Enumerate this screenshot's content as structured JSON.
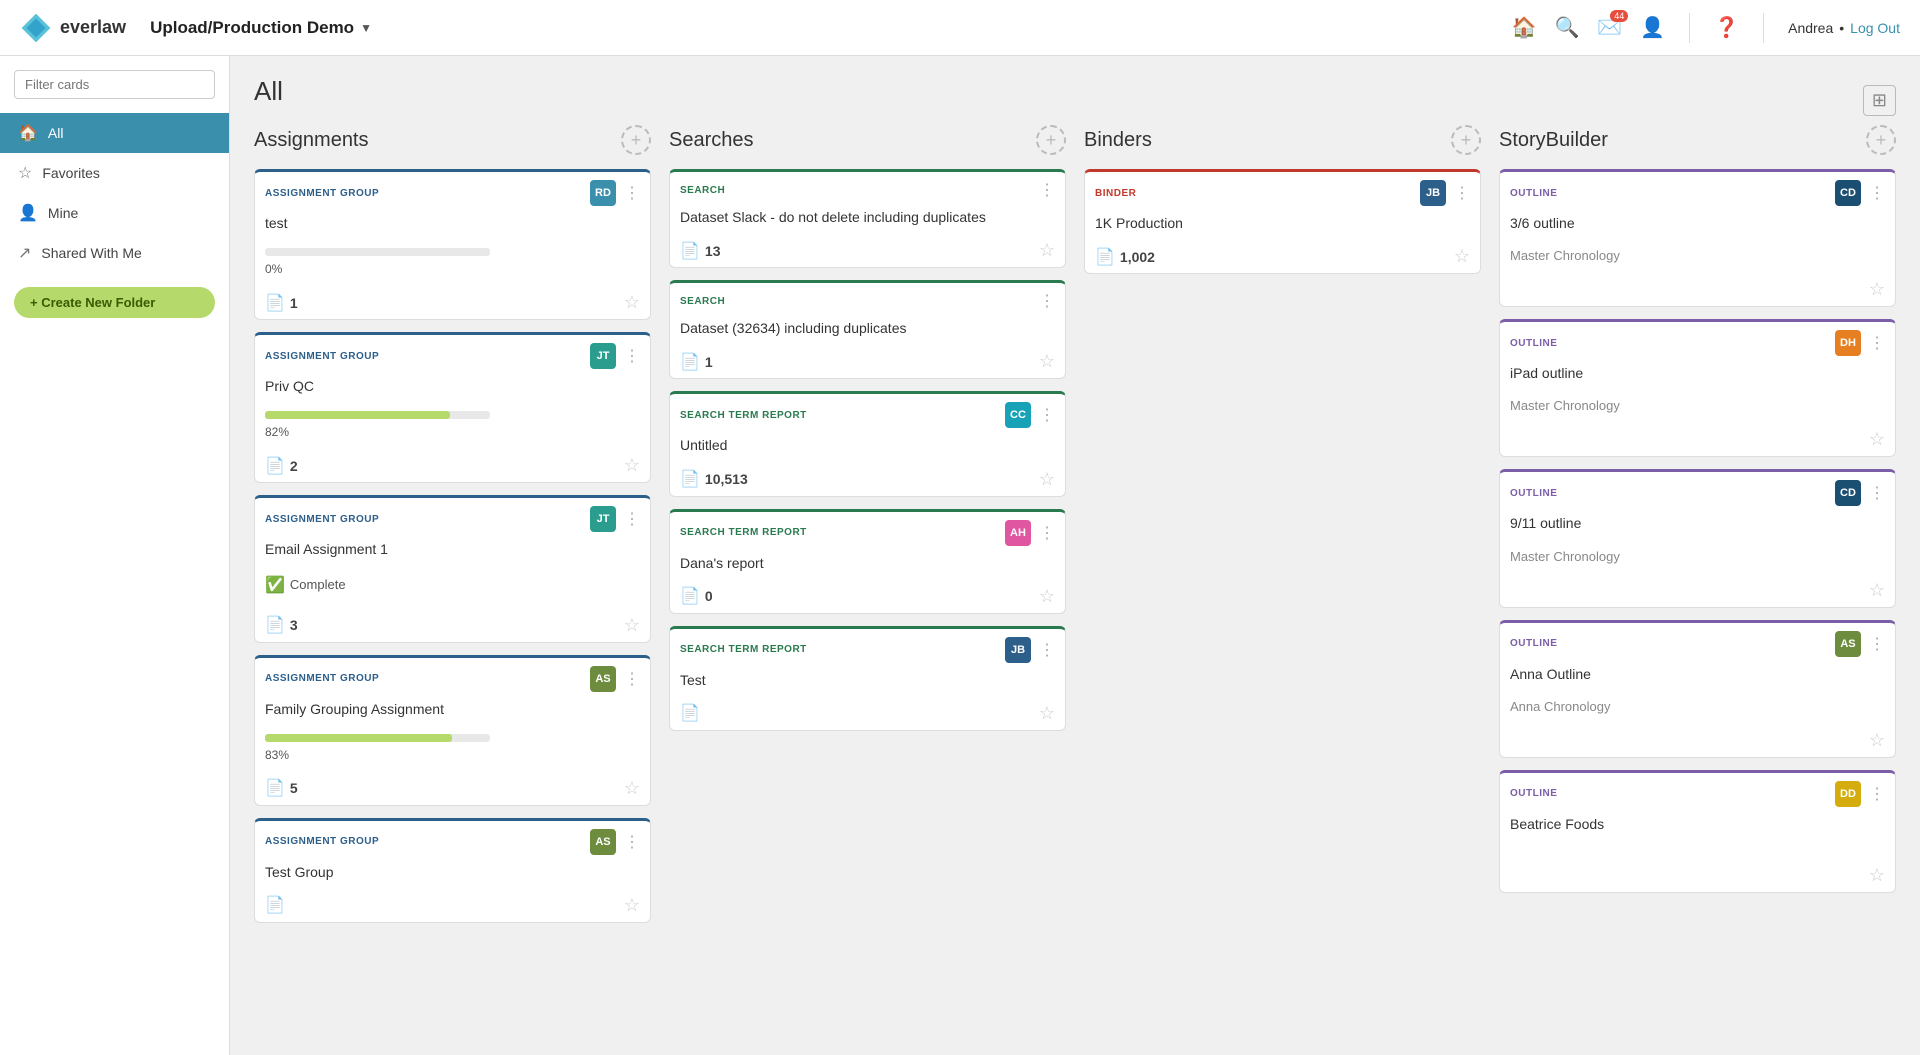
{
  "topnav": {
    "logo_text": "everlaw",
    "project_name": "Upload/Production Demo",
    "notification_count": "44",
    "user_name": "Andrea",
    "logout_label": "Log Out"
  },
  "sidebar": {
    "filter_placeholder": "Filter cards",
    "items": [
      {
        "id": "all",
        "label": "All",
        "icon": "🏠",
        "active": true
      },
      {
        "id": "favorites",
        "label": "Favorites",
        "icon": "☆",
        "active": false
      },
      {
        "id": "mine",
        "label": "Mine",
        "icon": "👤",
        "active": false
      },
      {
        "id": "shared",
        "label": "Shared With Me",
        "icon": "↗",
        "active": false
      }
    ],
    "create_folder_label": "+ Create New Folder"
  },
  "main": {
    "section_title": "All",
    "columns": [
      {
        "id": "assignments",
        "title": "Assignments",
        "cards": [
          {
            "type": "ASSIGNMENT GROUP",
            "type_key": "assignment",
            "name": "test",
            "avatar_initials": "RD",
            "avatar_color": "av-blue",
            "progress_pct": 0,
            "progress_label": "0%",
            "count": 1,
            "show_progress": true,
            "show_complete": false
          },
          {
            "type": "ASSIGNMENT GROUP",
            "type_key": "assignment",
            "name": "Priv QC",
            "avatar_initials": "JT",
            "avatar_color": "av-teal",
            "progress_pct": 82,
            "progress_label": "82%",
            "progress_color": "#b5d96b",
            "count": 2,
            "show_progress": true,
            "show_complete": false
          },
          {
            "type": "ASSIGNMENT GROUP",
            "type_key": "assignment",
            "name": "Email Assignment 1",
            "avatar_initials": "JT",
            "avatar_color": "av-teal",
            "progress_pct": 100,
            "progress_label": "Complete",
            "count": 3,
            "show_progress": false,
            "show_complete": true
          },
          {
            "type": "ASSIGNMENT GROUP",
            "type_key": "assignment",
            "name": "Family Grouping Assignment",
            "avatar_initials": "AS",
            "avatar_color": "av-olive",
            "progress_pct": 83,
            "progress_label": "83%",
            "progress_color": "#b5d96b",
            "count": 5,
            "show_progress": true,
            "show_complete": false
          },
          {
            "type": "ASSIGNMENT GROUP",
            "type_key": "assignment",
            "name": "Test Group",
            "avatar_initials": "AS",
            "avatar_color": "av-olive",
            "progress_pct": 0,
            "progress_label": "",
            "count": null,
            "show_progress": false,
            "show_complete": false
          }
        ]
      },
      {
        "id": "searches",
        "title": "Searches",
        "cards": [
          {
            "type": "SEARCH",
            "type_key": "search",
            "name": "Dataset Slack - do not delete including duplicates",
            "avatar_initials": null,
            "avatar_color": null,
            "count": 13,
            "count_label": "13"
          },
          {
            "type": "SEARCH",
            "type_key": "search",
            "name": "Dataset (32634) including duplicates",
            "avatar_initials": null,
            "avatar_color": null,
            "count": 1,
            "count_label": "1"
          },
          {
            "type": "SEARCH TERM REPORT",
            "type_key": "str",
            "name": "Untitled",
            "avatar_initials": "CC",
            "avatar_color": "av-cyan",
            "count": 10513,
            "count_label": "10,513"
          },
          {
            "type": "SEARCH TERM REPORT",
            "type_key": "str",
            "name": "Dana's report",
            "avatar_initials": "AH",
            "avatar_color": "av-pink",
            "count": 0,
            "count_label": "0"
          },
          {
            "type": "SEARCH TERM REPORT",
            "type_key": "str",
            "name": "Test",
            "avatar_initials": "JB",
            "avatar_color": "av-navy",
            "count": null,
            "count_label": ""
          }
        ]
      },
      {
        "id": "binders",
        "title": "Binders",
        "cards": [
          {
            "type": "BINDER",
            "type_key": "binder",
            "name": "1K Production",
            "avatar_initials": "JB",
            "avatar_color": "av-navy",
            "count": 1002,
            "count_label": "1,002"
          }
        ]
      },
      {
        "id": "storybuilder",
        "title": "StoryBuilder",
        "cards": [
          {
            "type": "OUTLINE",
            "type_key": "outline",
            "name": "3/6 outline",
            "sub_label": "Master Chronology",
            "avatar_initials": "CD",
            "avatar_color": "av-darkblue"
          },
          {
            "type": "OUTLINE",
            "type_key": "outline",
            "name": "iPad outline",
            "sub_label": "Master Chronology",
            "avatar_initials": "DH",
            "avatar_color": "av-orange"
          },
          {
            "type": "OUTLINE",
            "type_key": "outline",
            "name": "9/11 outline",
            "sub_label": "Master Chronology",
            "avatar_initials": "CD",
            "avatar_color": "av-darkblue"
          },
          {
            "type": "OUTLINE",
            "type_key": "outline",
            "name": "Anna Outline",
            "sub_label": "Anna Chronology",
            "avatar_initials": "AS",
            "avatar_color": "av-olive"
          },
          {
            "type": "OUTLINE",
            "type_key": "outline",
            "name": "Beatrice Foods",
            "sub_label": "",
            "avatar_initials": "DD",
            "avatar_color": "av-yellow"
          }
        ]
      }
    ]
  }
}
